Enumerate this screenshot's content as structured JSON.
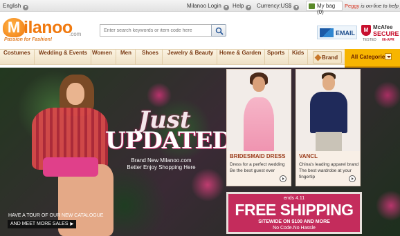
{
  "topbar": {
    "language": "English",
    "login": "Milanoo Login",
    "help": "Help",
    "currency": "Currency:US$",
    "bag": "My bag (0)",
    "chat_name": "Peggy",
    "chat_text": " is on-line to help you"
  },
  "header": {
    "logo_m": "M",
    "logo_word": "ilanoo",
    "logo_com": ".com",
    "tagline": "Passion for Fashion!",
    "search_placeholder": "Enter search keywords or item code here",
    "email_badge": "EMAIL",
    "mcafee_brand": "McAfee",
    "mcafee_secure": "SECURE",
    "mcafee_tested": "TESTED",
    "mcafee_date": "06-APR"
  },
  "nav": {
    "items": [
      "Costumes",
      "Wedding & Events",
      "Women",
      "Men",
      "Shoes",
      "Jewelry & Beauty",
      "Home & Garden",
      "Sports",
      "Kids"
    ],
    "brand": "Brand",
    "all_categories": "All Categories"
  },
  "hero": {
    "headline_1": "Just",
    "headline_2": "UPDATED!",
    "sub_1": "Brand New Milanoo.com",
    "sub_2": "Better Enjoy Shopping Here",
    "tour_1": "HAVE A TOUR OF OUR NEW CATALOGUE",
    "tour_2": "AND MEET MORE SALES"
  },
  "cards": [
    {
      "title": "BRIDESMAID DRESS",
      "desc": "Dress for a perfect wedding Be the best guest ever"
    },
    {
      "title": "VANCL",
      "desc": "China's leading apparel brand The best wardrobe at your fingertip"
    }
  ],
  "promo": {
    "ends": "ends 4.11",
    "headline": "FREE SHIPPING",
    "sitewide": "SITEWIDE ON $100 AND MORE",
    "no_code": "No Code.No Hassle"
  },
  "colors": {
    "brand_orange": "#f07a10",
    "nav_text": "#7a3a13",
    "all_categories_bg": "#f7b500",
    "promo_bg": "#c42c5c"
  }
}
